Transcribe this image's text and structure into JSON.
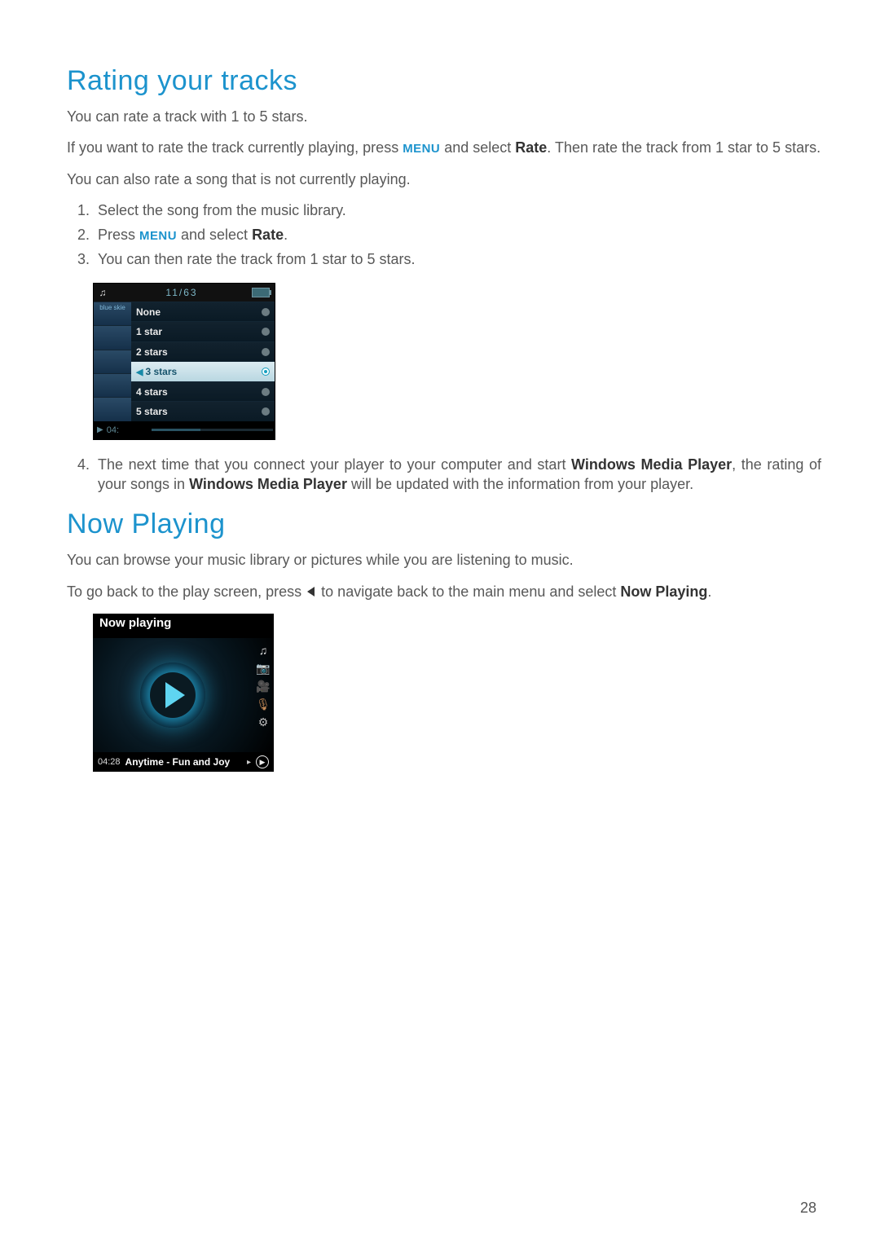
{
  "section1": {
    "title": "Rating your tracks",
    "p1": "You can rate a track with 1 to 5 stars.",
    "p2a": "If you want to rate the track currently playing, press ",
    "p2_menu": "MENU",
    "p2b": " and select ",
    "p2_rate": "Rate",
    "p2c": ". Then rate the track from 1 star to 5 stars.",
    "p3": "You can also rate a song that is not currently playing.",
    "steps": {
      "s1": "Select the song from the music library.",
      "s2a": "Press ",
      "s2_menu": "MENU",
      "s2b": " and select ",
      "s2_rate": "Rate",
      "s2c": ".",
      "s3": "You can then rate the track from 1 star to 5 stars.",
      "s4a": "The next time that you connect your player to your computer and start ",
      "s4_wmp": "Windows Media Player",
      "s4b": ", the rating of your songs in ",
      "s4c": " will be updated with the information from your player."
    }
  },
  "rating_device": {
    "status_count": "11/63",
    "thumb_label": "blue skie",
    "options": [
      "None",
      "1 star",
      "2 stars",
      "3 stars",
      "4 stars",
      "5 stars"
    ],
    "selected_index": 3,
    "foot_time": "04:"
  },
  "section2": {
    "title": "Now Playing",
    "p1": "You can browse your music library or pictures while you are listening to music.",
    "p2a": "To go back to the play screen, press ",
    "p2b": " to navigate back to the main menu and select ",
    "p2_np": "Now Playing",
    "p2c": "."
  },
  "np_device": {
    "header": "Now playing",
    "time": "04:28",
    "track": "Anytime - Fun and Joy"
  },
  "page_number": "28"
}
